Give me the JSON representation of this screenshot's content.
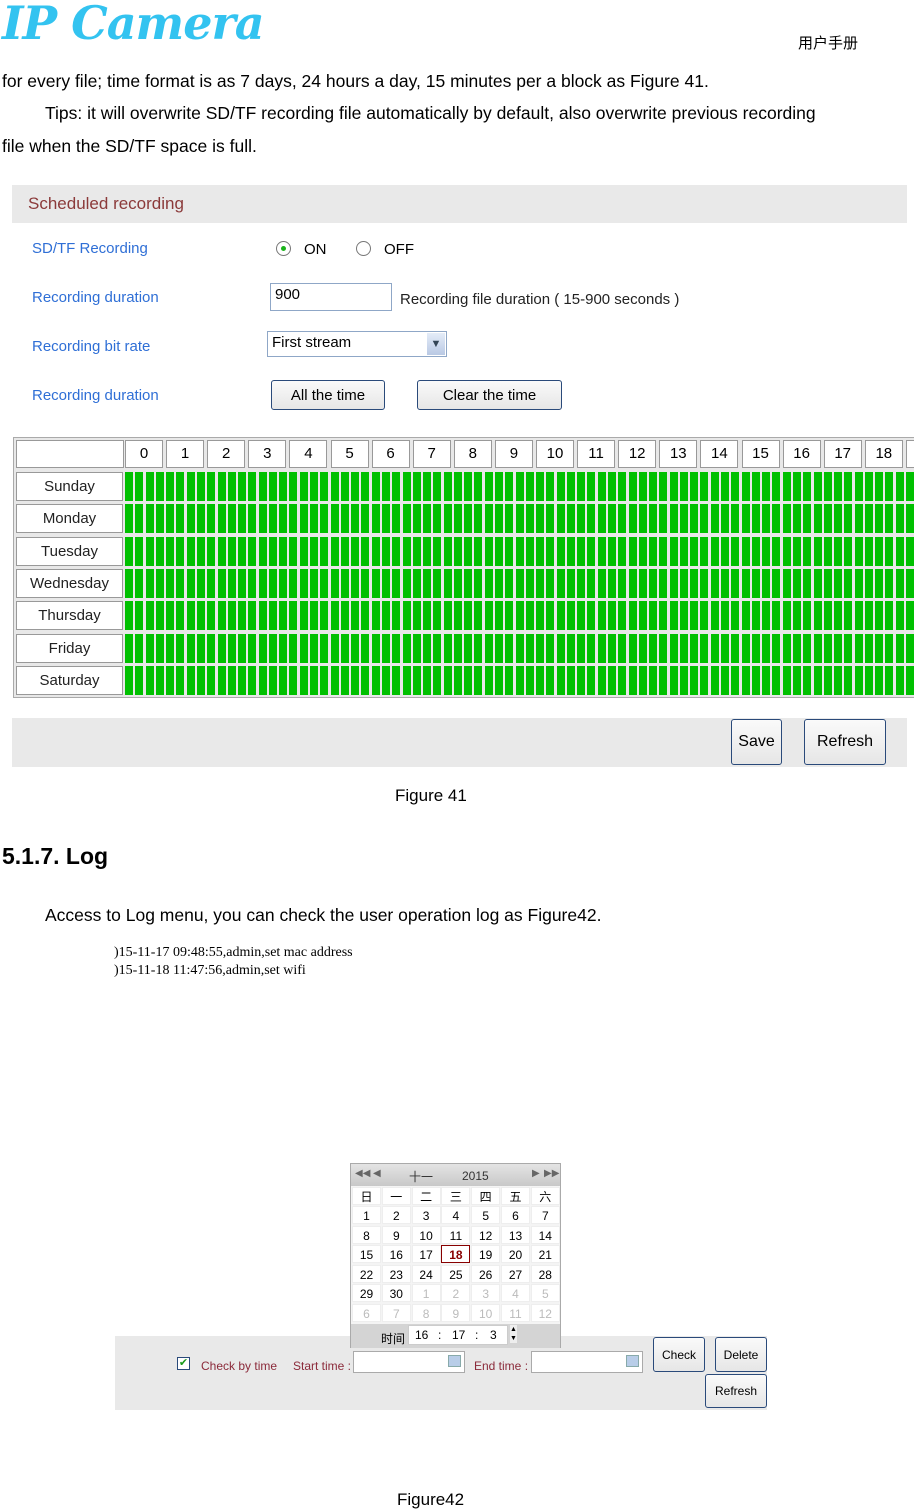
{
  "header": {
    "logo_text": "IP Camera",
    "manual_label": "用户手册"
  },
  "text": {
    "line1": "for every file; time format is as 7 days, 24 hours a day, 15 minutes per a block as Figure 41.",
    "line2": "Tips: it will overwrite SD/TF recording file automatically by default, also overwrite previous recording",
    "line3": "file when the SD/TF space is full.",
    "fig41": "Figure 41",
    "section": "5.1.7.  Log",
    "log_intro": "Access to Log menu, you can check the user operation log as Figure42.",
    "fig42": "Figure42"
  },
  "schedule": {
    "title": "Scheduled recording",
    "sd_label": "SD/TF Recording",
    "on": "ON",
    "off": "OFF",
    "selected": "ON",
    "duration_label": "Recording duration",
    "duration_value": "900",
    "duration_hint": "Recording file duration ( 15-900 seconds )",
    "bitrate_label": "Recording bit rate",
    "bitrate_value": "First stream",
    "range_label": "Recording duration",
    "all_btn": "All the time",
    "clear_btn": "Clear the time",
    "hours": [
      "0",
      "1",
      "2",
      "3",
      "4",
      "5",
      "6",
      "7",
      "8",
      "9",
      "10",
      "11",
      "12",
      "13",
      "14",
      "15",
      "16",
      "17",
      "18"
    ],
    "days": [
      "Sunday",
      "Monday",
      "Tuesday",
      "Wednesday",
      "Thursday",
      "Friday",
      "Saturday"
    ],
    "all_blocks_selected": true,
    "block_color": "#00c000",
    "save": "Save",
    "refresh": "Refresh"
  },
  "log": {
    "entries": [
      ")15-11-17 09:48:55,admin,set mac address",
      ")15-11-18 11:47:56,admin,set wifi"
    ],
    "calendar": {
      "month": "十一",
      "year": "2015",
      "weekdays": [
        "日",
        "一",
        "二",
        "三",
        "四",
        "五",
        "六"
      ],
      "days": [
        [
          "1",
          "2",
          "3",
          "4",
          "5",
          "6",
          "7"
        ],
        [
          "8",
          "9",
          "10",
          "11",
          "12",
          "13",
          "14"
        ],
        [
          "15",
          "16",
          "17",
          "18",
          "19",
          "20",
          "21"
        ],
        [
          "22",
          "23",
          "24",
          "25",
          "26",
          "27",
          "28"
        ],
        [
          "29",
          "30",
          "1",
          "2",
          "3",
          "4",
          "5"
        ],
        [
          "6",
          "7",
          "8",
          "9",
          "10",
          "11",
          "12"
        ]
      ],
      "selected": "18",
      "time_label": "时间",
      "hour": "16",
      "minute": "17",
      "second": "3"
    },
    "check_by_time": "Check by time",
    "checked": true,
    "start_label": "Start time :",
    "end_label": "End time :",
    "check": "Check",
    "delete": "Delete",
    "refresh": "Refresh"
  }
}
